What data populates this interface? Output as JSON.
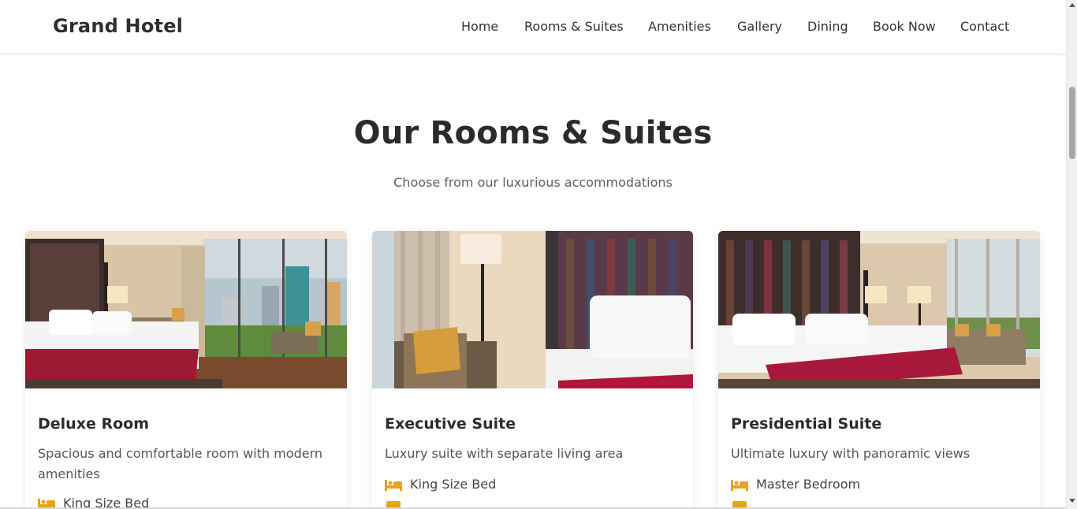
{
  "header": {
    "logo": "Grand Hotel",
    "nav": [
      "Home",
      "Rooms & Suites",
      "Amenities",
      "Gallery",
      "Dining",
      "Book Now",
      "Contact"
    ]
  },
  "section": {
    "title": "Our Rooms & Suites",
    "subtitle": "Choose from our luxurious accommodations"
  },
  "rooms": [
    {
      "title": "Deluxe Room",
      "description": "Spacious and comfortable room with modern amenities",
      "features": [
        "King Size Bed"
      ]
    },
    {
      "title": "Executive Suite",
      "description": "Luxury suite with separate living area",
      "features": [
        "King Size Bed"
      ]
    },
    {
      "title": "Presidential Suite",
      "description": "Ultimate luxury with panoramic views",
      "features": [
        "Master Bedroom"
      ]
    }
  ],
  "icons": {
    "feature": "bed-icon"
  },
  "colors": {
    "accent": "#e8a21c",
    "bedThrow": "#b31936"
  }
}
